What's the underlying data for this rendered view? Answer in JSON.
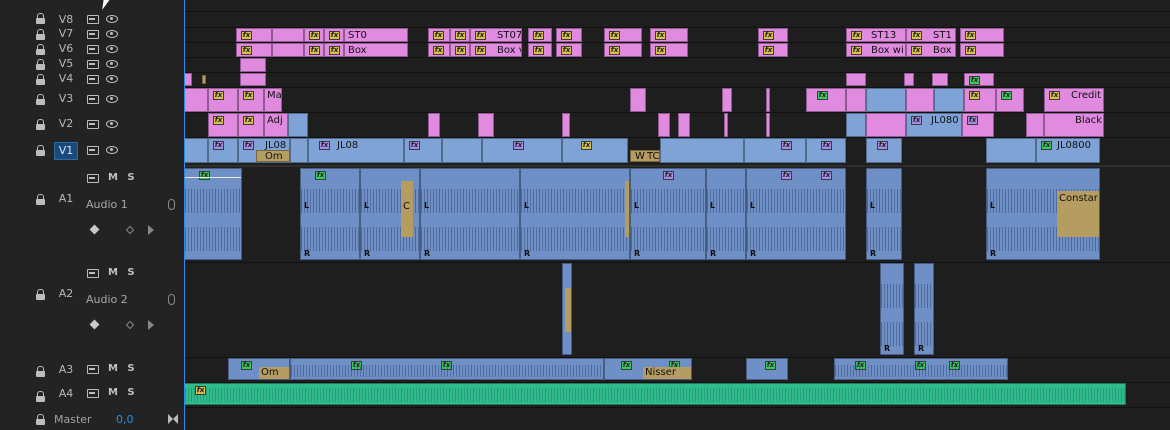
{
  "video_tracks": [
    {
      "name": "V8",
      "active": false
    },
    {
      "name": "V7",
      "active": false
    },
    {
      "name": "V6",
      "active": false
    },
    {
      "name": "V5",
      "active": false
    },
    {
      "name": "V4",
      "active": false
    },
    {
      "name": "V3",
      "active": false
    },
    {
      "name": "V2",
      "active": false
    },
    {
      "name": "V1",
      "active": true
    }
  ],
  "audio_tracks": [
    {
      "name": "A1",
      "label": "Audio 1",
      "mute": "M",
      "solo": "S"
    },
    {
      "name": "A2",
      "label": "Audio 2",
      "mute": "M",
      "solo": "S"
    },
    {
      "name": "A3",
      "mute": "M",
      "solo": "S"
    },
    {
      "name": "A4",
      "mute": "M",
      "solo": "S"
    }
  ],
  "master": {
    "label": "Master",
    "value": "0,0"
  },
  "fx_badge": "fx",
  "clip_labels": {
    "v7_st0": "ST0",
    "v7_st07": "ST07",
    "v7_st13": "ST13",
    "v7_st1": "ST1",
    "v6_box": "Box",
    "v6_boxv": "Box v",
    "v6_boxwi": "Box wi",
    "v6_box2": "Box",
    "v3_mas": "Mas",
    "v3_credit": "Credit",
    "v2_adj": "Adj",
    "v2_jl080": "JL080",
    "v2_black": "Black",
    "v1_jl08a": "JL08",
    "v1_jl08b": "JL08",
    "v1_jl080": "JL0800",
    "v1_om": "Om",
    "v1_w": "W",
    "v1_tc": "TC",
    "a1_c": "C",
    "a1_cl": "C",
    "a1_constar": "Constar",
    "a3_om": "Om",
    "a3_nisser": "Nisser",
    "lr_l": "L",
    "lr_r": "R"
  },
  "colors": {
    "playhead": "#2d8ceb",
    "graphic_clip": "#e08ae0",
    "video_clip": "#7fa3d6",
    "audio_clip": "#6f8fc7",
    "music_clip": "#2ebc8b",
    "active_track": "#1a4a77"
  },
  "icons": [
    "lock-icon",
    "film-icon",
    "eye-icon",
    "mic-icon",
    "keyframe-add-icon",
    "keyframe-icon",
    "next-keyframe-icon",
    "master-jump-icon",
    "cursor-icon"
  ]
}
